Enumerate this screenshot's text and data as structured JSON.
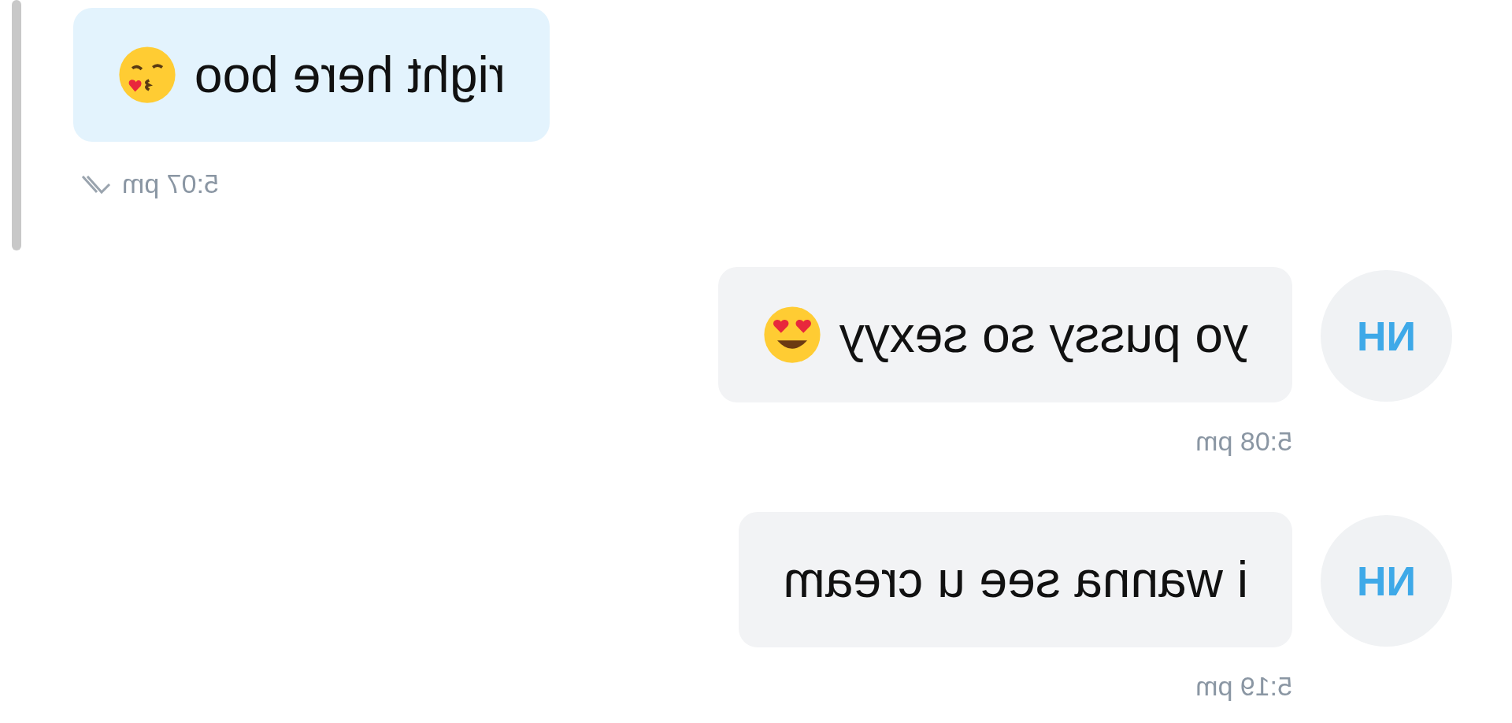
{
  "messages": [
    {
      "kind": "sent",
      "text": "right here boo",
      "time": "5:07 pm",
      "read": true
    },
    {
      "kind": "received",
      "avatar": "NH",
      "text": "yo pussy so sexyy",
      "time": "5:08 pm"
    },
    {
      "kind": "received",
      "avatar": "NH",
      "text": "i wanna see u cream",
      "time": "5:19 pm"
    }
  ]
}
